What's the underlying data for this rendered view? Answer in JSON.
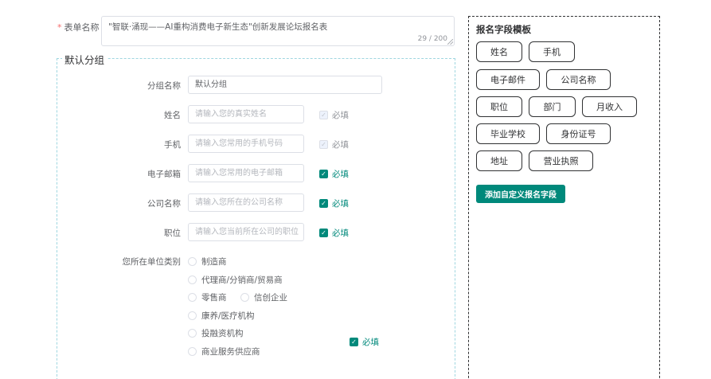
{
  "form": {
    "required_mark": "*",
    "label": "表单名称",
    "value": "\"智联·涌现——AI重构消费电子新生态\"创新发展论坛报名表",
    "counter": "29 / 200"
  },
  "group": {
    "legend": "默认分组",
    "name_label": "分组名称",
    "name_value": "默认分组",
    "required_label": "必填",
    "fields": [
      {
        "label": "姓名",
        "placeholder": "请输入您的真实姓名",
        "required": true,
        "locked": true
      },
      {
        "label": "手机",
        "placeholder": "请输入您常用的手机号码",
        "required": true,
        "locked": true
      },
      {
        "label": "电子邮箱",
        "placeholder": "请输入您常用的电子邮箱",
        "required": true,
        "locked": false
      },
      {
        "label": "公司名称",
        "placeholder": "请输入您所在的公司名称",
        "required": true,
        "locked": false
      },
      {
        "label": "职位",
        "placeholder": "请输入您当前所在公司的职位",
        "required": true,
        "locked": false
      }
    ],
    "unit_type": {
      "label": "您所在单位类别",
      "options": [
        "制造商",
        "代理商/分销商/贸易商",
        "零售商",
        "信创企业",
        "康养/医疗机构",
        "投融资机构",
        "商业服务供应商"
      ],
      "required": true
    }
  },
  "template": {
    "title": "报名字段模板",
    "chips": [
      "姓名",
      "手机",
      "电子邮件",
      "公司名称",
      "职位",
      "部门",
      "月收入",
      "毕业学校",
      "身份证号",
      "地址",
      "营业执照"
    ],
    "add_button": "添加自定义报名字段"
  },
  "colors": {
    "accent": "#00897b",
    "required_star": "#f56c6c"
  }
}
